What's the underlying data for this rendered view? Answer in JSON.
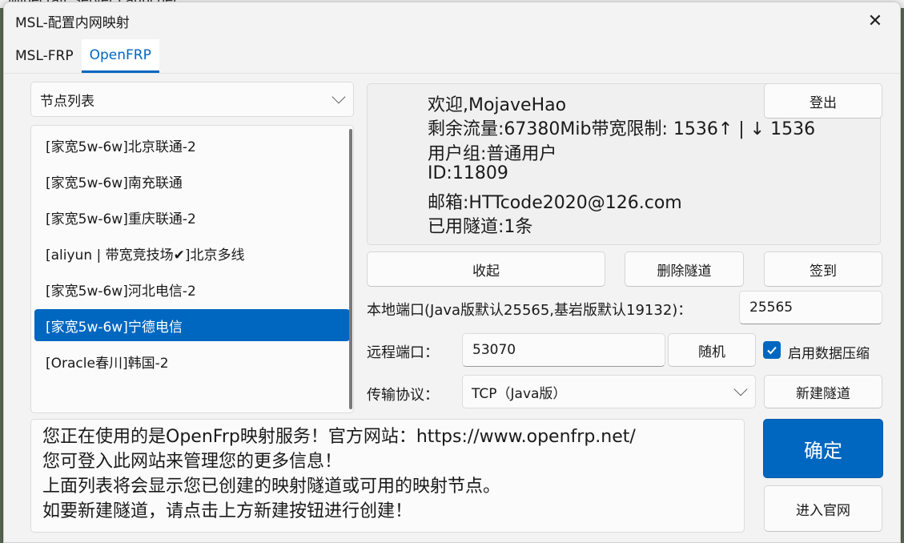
{
  "background_app": {
    "partial_title": "Minecraft Server Launcher"
  },
  "window": {
    "title": "MSL-配置内网映射",
    "close_glyph": "✕"
  },
  "tabs": [
    {
      "label": "MSL-FRP",
      "active": false
    },
    {
      "label": "OpenFRP",
      "active": true
    }
  ],
  "node_selector": {
    "value": "节点列表"
  },
  "nodes": [
    {
      "label": "[家宽5w-6w]北京联通-2",
      "selected": false
    },
    {
      "label": "[家宽5w-6w]南充联通",
      "selected": false
    },
    {
      "label": "[家宽5w-6w]重庆联通-2",
      "selected": false
    },
    {
      "label": "[aliyun | 带宽竞技场✔]北京多线",
      "selected": false
    },
    {
      "label": "[家宽5w-6w]河北电信-2",
      "selected": false
    },
    {
      "label": "[家宽5w-6w]宁德电信",
      "selected": true
    },
    {
      "label": "[Oracle春川]韩国-2",
      "selected": false
    }
  ],
  "user_info": {
    "welcome": "欢迎,MojaveHao",
    "traffic": "剩余流量:67380Mib带宽限制: 1536↑ | ↓ 1536",
    "group": "用户组:普通用户",
    "id": "ID:11809",
    "email": "邮箱:HTTcode2020@126.com",
    "tunnels": "已用隧道:1条"
  },
  "buttons": {
    "logout": "登出",
    "collapse": "收起",
    "delete_tunnel": "删除隧道",
    "sign_in": "签到",
    "random": "随机",
    "new_tunnel": "新建隧道",
    "confirm": "确定",
    "visit_site": "进入官网"
  },
  "form": {
    "local_port_label": "本地端口(Java版默认25565,基岩版默认19132)：",
    "local_port_value": "25565",
    "remote_port_label": "远程端口：",
    "remote_port_value": "53070",
    "compression_label": "启用数据压缩",
    "compression_checked": true,
    "protocol_label": "传输协议：",
    "protocol_value": "TCP（Java版）"
  },
  "message": [
    "您正在使用的是OpenFrp映射服务！官方网站：https://www.openfrp.net/",
    "您可登入此网站来管理您的更多信息！",
    "上面列表将会显示您已创建的映射隧道或可用的映射节点。",
    "如要新建隧道，请点击上方新建按钮进行创建！"
  ],
  "colors": {
    "accent": "#0067c0",
    "window_bg": "#f3f3f3",
    "control_bg": "#fbfbfb"
  }
}
